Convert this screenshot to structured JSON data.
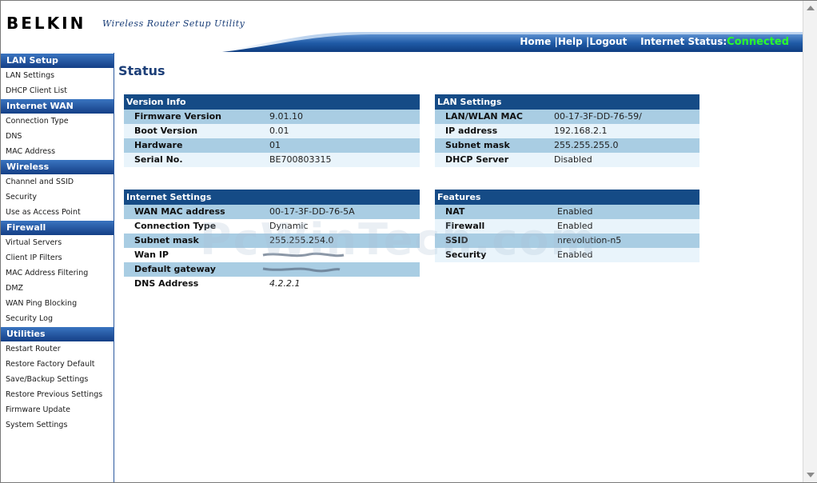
{
  "header": {
    "brand": "BELKIN",
    "subtitle": "Wireless Router Setup Utility",
    "links": [
      "Home |",
      "Help |",
      "Logout"
    ],
    "status_label": "Internet Status:",
    "status_value": "Connected"
  },
  "sidebar": {
    "sections": [
      {
        "title": "LAN Setup",
        "items": [
          "LAN Settings",
          "DHCP Client List"
        ]
      },
      {
        "title": "Internet WAN",
        "items": [
          "Connection Type",
          "DNS",
          "MAC Address"
        ]
      },
      {
        "title": "Wireless",
        "items": [
          "Channel and SSID",
          "Security",
          "Use as Access Point"
        ]
      },
      {
        "title": "Firewall",
        "items": [
          "Virtual Servers",
          "Client IP Filters",
          "MAC Address Filtering",
          "DMZ",
          "WAN Ping Blocking",
          "Security Log"
        ]
      },
      {
        "title": "Utilities",
        "items": [
          "Restart Router",
          "Restore Factory Default",
          "Save/Backup Settings",
          "Restore Previous Settings",
          "Firmware Update",
          "System Settings"
        ]
      }
    ]
  },
  "main": {
    "title": "Status",
    "version_info": {
      "title": "Version Info",
      "rows": [
        {
          "label": "Firmware Version",
          "value": "9.01.10"
        },
        {
          "label": "Boot Version",
          "value": "0.01"
        },
        {
          "label": "Hardware",
          "value": "01"
        },
        {
          "label": "Serial No.",
          "value": "BE700803315"
        }
      ]
    },
    "lan_settings": {
      "title": "LAN Settings",
      "rows": [
        {
          "label": "LAN/WLAN MAC",
          "value": "00-17-3F-DD-76-59/"
        },
        {
          "label": "IP address",
          "value": "192.168.2.1"
        },
        {
          "label": "Subnet mask",
          "value": "255.255.255.0"
        },
        {
          "label": "DHCP Server",
          "value": "Disabled"
        }
      ]
    },
    "internet_settings": {
      "title": "Internet Settings",
      "rows": [
        {
          "label": "WAN MAC address",
          "value": "00-17-3F-DD-76-5A"
        },
        {
          "label": "Connection Type",
          "value": "Dynamic"
        },
        {
          "label": "Subnet mask",
          "value": "255.255.254.0"
        },
        {
          "label": "Wan IP",
          "value": ""
        },
        {
          "label": "Default gateway",
          "value": ""
        },
        {
          "label": "DNS Address",
          "value": "4.2.2.1"
        }
      ]
    },
    "features": {
      "title": "Features",
      "rows": [
        {
          "label": "NAT",
          "value": "Enabled"
        },
        {
          "label": "Firewall",
          "value": "Enabled"
        },
        {
          "label": "SSID",
          "value": "nrevolution-n5"
        },
        {
          "label": "Security",
          "value": "Enabled"
        }
      ]
    },
    "watermark": "PcWinTech.com"
  },
  "colors": {
    "header_blue": "#154b86",
    "status_green": "#2bff2b",
    "row_odd": "#a9cde3",
    "row_even": "#e9f4fb"
  }
}
